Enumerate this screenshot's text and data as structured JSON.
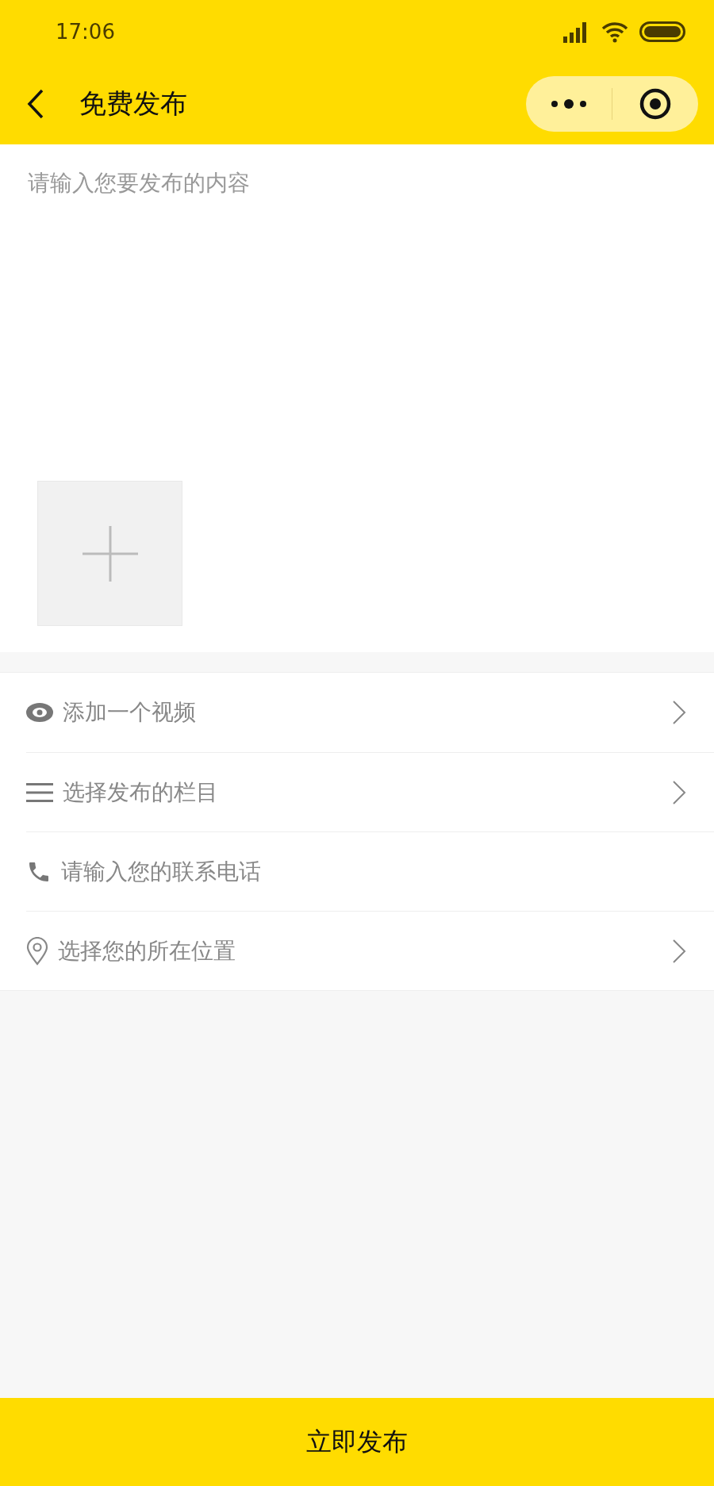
{
  "status_bar": {
    "time": "17:06"
  },
  "nav": {
    "title": "免费发布"
  },
  "content": {
    "placeholder": "请输入您要发布的内容"
  },
  "options": [
    {
      "kind": "video",
      "label": "添加一个视频"
    },
    {
      "kind": "category",
      "label": "选择发布的栏目"
    },
    {
      "kind": "phone",
      "placeholder": "请输入您的联系电话"
    },
    {
      "kind": "location",
      "label": "选择您的所在位置"
    }
  ],
  "submit": {
    "label": "立即发布"
  }
}
